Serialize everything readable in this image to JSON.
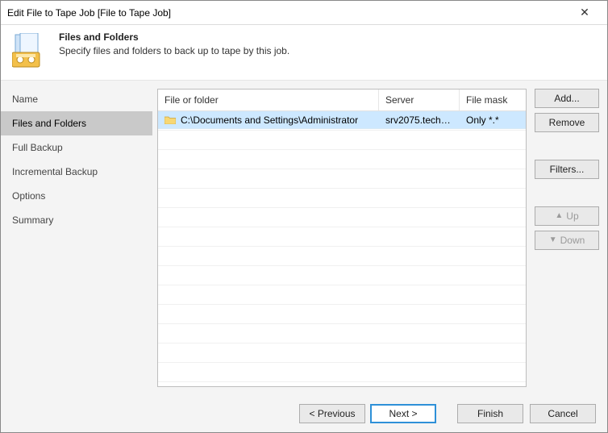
{
  "window": {
    "title": "Edit File to Tape Job [File to Tape Job]"
  },
  "header": {
    "title": "Files and Folders",
    "subtitle": "Specify files and folders to back up to tape by this job."
  },
  "sidebar": {
    "items": [
      {
        "label": "Name"
      },
      {
        "label": "Files and Folders"
      },
      {
        "label": "Full Backup"
      },
      {
        "label": "Incremental Backup"
      },
      {
        "label": "Options"
      },
      {
        "label": "Summary"
      }
    ],
    "selectedIndex": 1
  },
  "table": {
    "headers": {
      "path": "File or folder",
      "server": "Server",
      "mask": "File mask"
    },
    "rows": [
      {
        "path": "C:\\Documents and Settings\\Administrator",
        "server": "srv2075.tech.l...",
        "mask": "Only *.*"
      }
    ]
  },
  "buttons": {
    "add": "Add...",
    "remove": "Remove",
    "filters": "Filters...",
    "up": "Up",
    "down": "Down"
  },
  "wizard": {
    "prev": "< Previous",
    "next": "Next >",
    "finish": "Finish",
    "cancel": "Cancel"
  },
  "icons": {
    "close": "✕"
  }
}
